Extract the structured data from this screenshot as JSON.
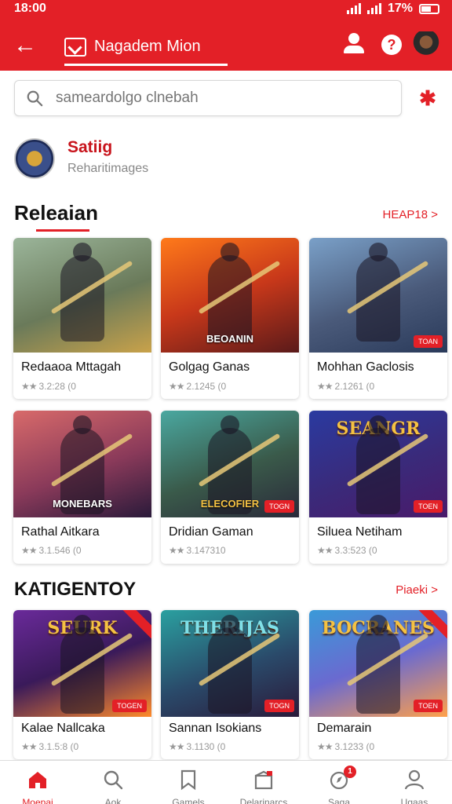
{
  "status_bar": {
    "time": "18:00",
    "battery": "17%"
  },
  "header": {
    "title": "Nagadem Mion"
  },
  "search": {
    "placeholder": "sameardolgo clnebah"
  },
  "profile": {
    "name": "Satiig",
    "subtitle": "Reharitimages"
  },
  "sections": [
    {
      "title": "Releaian",
      "link": "HEAP18 >",
      "cards": [
        {
          "name": "Redaaoa Mttagah",
          "rating": "3.2:28 (0",
          "art_text": "",
          "tag": "",
          "colors": [
            "#9bb59a",
            "#c9a24a"
          ]
        },
        {
          "name": "Golgag Ganas",
          "rating": "2.1245 (0",
          "art_text": "BEOANIN",
          "tag": "",
          "colors": [
            "#ff7a1a",
            "#5a1a1a"
          ]
        },
        {
          "name": "Mohhan Gaclosis",
          "rating": "2.1261 (0",
          "art_text": "",
          "tag": "TOAN",
          "colors": [
            "#7aa0c8",
            "#2a3a5a"
          ]
        }
      ]
    },
    {
      "title": "",
      "link": "",
      "cards": [
        {
          "name": "Rathal Aitkara",
          "rating": "3.1.546 (0",
          "art_text": "MONEBARS",
          "tag": "",
          "colors": [
            "#d86a6a",
            "#2a1a3a"
          ]
        },
        {
          "name": "Dridian Gaman",
          "rating": "3.147310",
          "art_text": "ELECOFIER",
          "tag": "TOGN",
          "colors": [
            "#4aa8a0",
            "#2a2a3a"
          ]
        },
        {
          "name": "Siluea Netiham",
          "rating": "3.3:523 (0",
          "art_text": "SEANGR",
          "tag": "TOEN",
          "colors": [
            "#2a3aa0",
            "#4a1a6a"
          ]
        }
      ]
    },
    {
      "title": "KATIGENTOY",
      "link": "Piaeki >",
      "cards": [
        {
          "name": "Kalae Nallcaka",
          "rating": "3.1.5:8 (0",
          "art_text": "SEURK",
          "tag": "TOGEN",
          "colors": [
            "#6a2a9a",
            "#ff8a2a"
          ]
        },
        {
          "name": "Sannan Isokians",
          "rating": "3.1130 (0",
          "art_text": "THERIJAS",
          "tag": "TOGN",
          "colors": [
            "#2aa0a0",
            "#2a1a3a"
          ]
        },
        {
          "name": "Demarain",
          "rating": "3.1233 (0",
          "art_text": "BOCRANES",
          "tag": "TOEN",
          "colors": [
            "#3a9ad8",
            "#ffa04a"
          ]
        }
      ]
    }
  ],
  "bottom_nav": [
    {
      "label": "Moepai",
      "icon": "home-icon",
      "active": true
    },
    {
      "label": "Aok",
      "icon": "search-icon",
      "active": false
    },
    {
      "label": "Gamels",
      "icon": "bookmark-icon",
      "active": false
    },
    {
      "label": "Delarinarcs",
      "icon": "box-icon",
      "active": false
    },
    {
      "label": "Saga",
      "icon": "compass-icon",
      "active": false,
      "badge": "1"
    },
    {
      "label": "Ugaas",
      "icon": "profile-icon",
      "active": false
    }
  ],
  "accent_color": "#e32027"
}
